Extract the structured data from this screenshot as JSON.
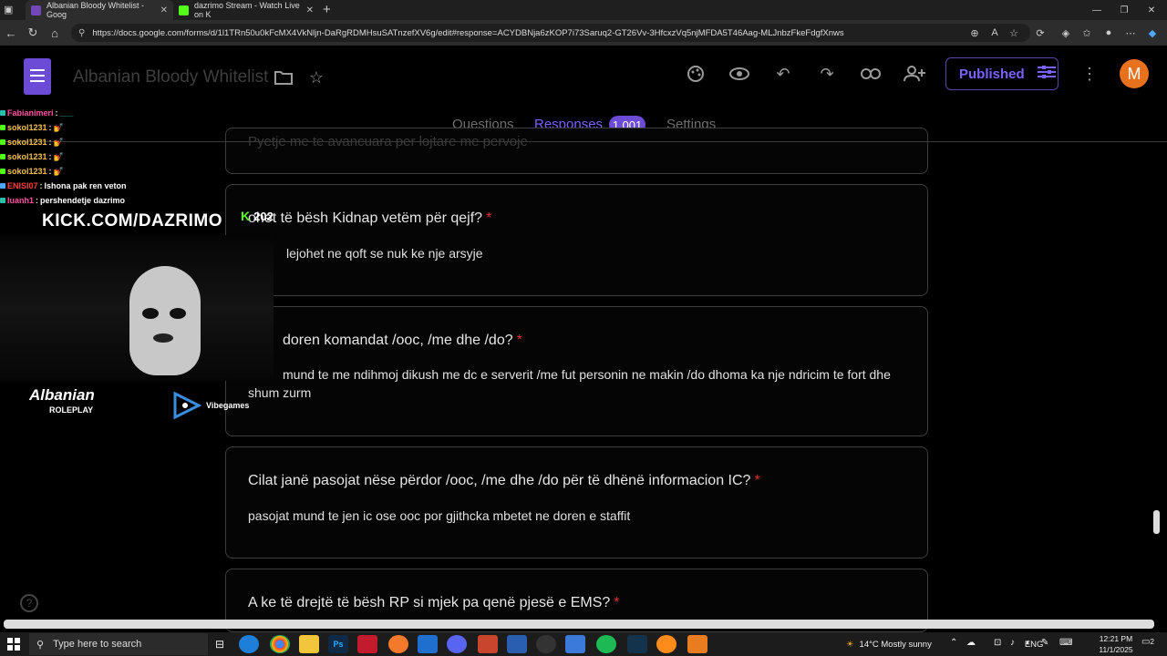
{
  "browser": {
    "tabs": [
      {
        "label": "Albanian Bloody Whitelist - Goog",
        "favicon_color": "#7248b9"
      },
      {
        "label": "dazrimo Stream - Watch Live on K",
        "favicon_color": "#53fc18"
      }
    ],
    "new_tab": "+",
    "url": "https://docs.google.com/forms/d/1l1TRn50u0kFcMX4VkNljn-DaRgRDMHsuSATnzefXV6g/edit#response=ACYDBNja6zKOP7i73Saruq2-GT26Vv-3HfcxzVq5njMFDA5T46Aag-MLJnbzFkeFdgfXnws"
  },
  "form": {
    "title": "Albanian Bloody Whitelist",
    "publish_label": "Published",
    "avatar_initial": "M",
    "tabs": [
      "Questions",
      "Responses",
      "Settings"
    ],
    "response_count": "1,001"
  },
  "cards": [
    {
      "question": "Pyetje me te avancuara per lojtare me pervoje",
      "answer": ""
    },
    {
      "question": "ohet të bësh Kidnap vetëm për qejf?",
      "answer": "lejohet ne qoft se nuk ke nje arsyje"
    },
    {
      "question": "doren komandat /ooc, /me dhe /do?",
      "answer": "mund te me ndihmoj dikush me dc e serverit      /me  fut personin ne makin      /do dhoma ka nje  ndricim te fort dhe shum zurm"
    },
    {
      "question": "Cilat janë pasojat nëse përdor /ooc, /me dhe /do për të dhënë informacion IC?",
      "answer": "pasojat mund te jen ic ose ooc por gjithcka mbetet ne doren e staffit"
    },
    {
      "question": "A ke të drejtë të bësh RP si mjek pa qenë pjesë e EMS?",
      "answer": ""
    }
  ],
  "required_mark": "*",
  "stream": {
    "chat": [
      {
        "user": "Fabianimeri",
        "msg": "___",
        "color": "#ff4fa3"
      },
      {
        "user": "sokol1231",
        "msg": "💅",
        "color": "#f5c04a"
      },
      {
        "user": "sokol1231",
        "msg": "💅",
        "color": "#f5c04a"
      },
      {
        "user": "sokol1231",
        "msg": "💅",
        "color": "#f5c04a"
      },
      {
        "user": "sokol1231",
        "msg": "💅",
        "color": "#f5c04a"
      },
      {
        "user": "ENISI07",
        "msg": "lshona pak ren veton",
        "color": "#ff3b3b"
      },
      {
        "user": "luanh1",
        "msg": "pershendetje dazrimo",
        "color": "#ff4fa3"
      }
    ],
    "kick_url": "KICK.COM/DAZRIMO",
    "viewers": "202",
    "brand_name": "Albanian",
    "brand_sub": "ROLEPLAY",
    "sponsor": "Vibegames"
  },
  "taskbar": {
    "search_placeholder": "Type here to search",
    "weather": "14°C  Mostly sunny",
    "lang": "ENG",
    "time": "12:21 PM",
    "date": "11/1/2025",
    "notif_count": "2"
  }
}
